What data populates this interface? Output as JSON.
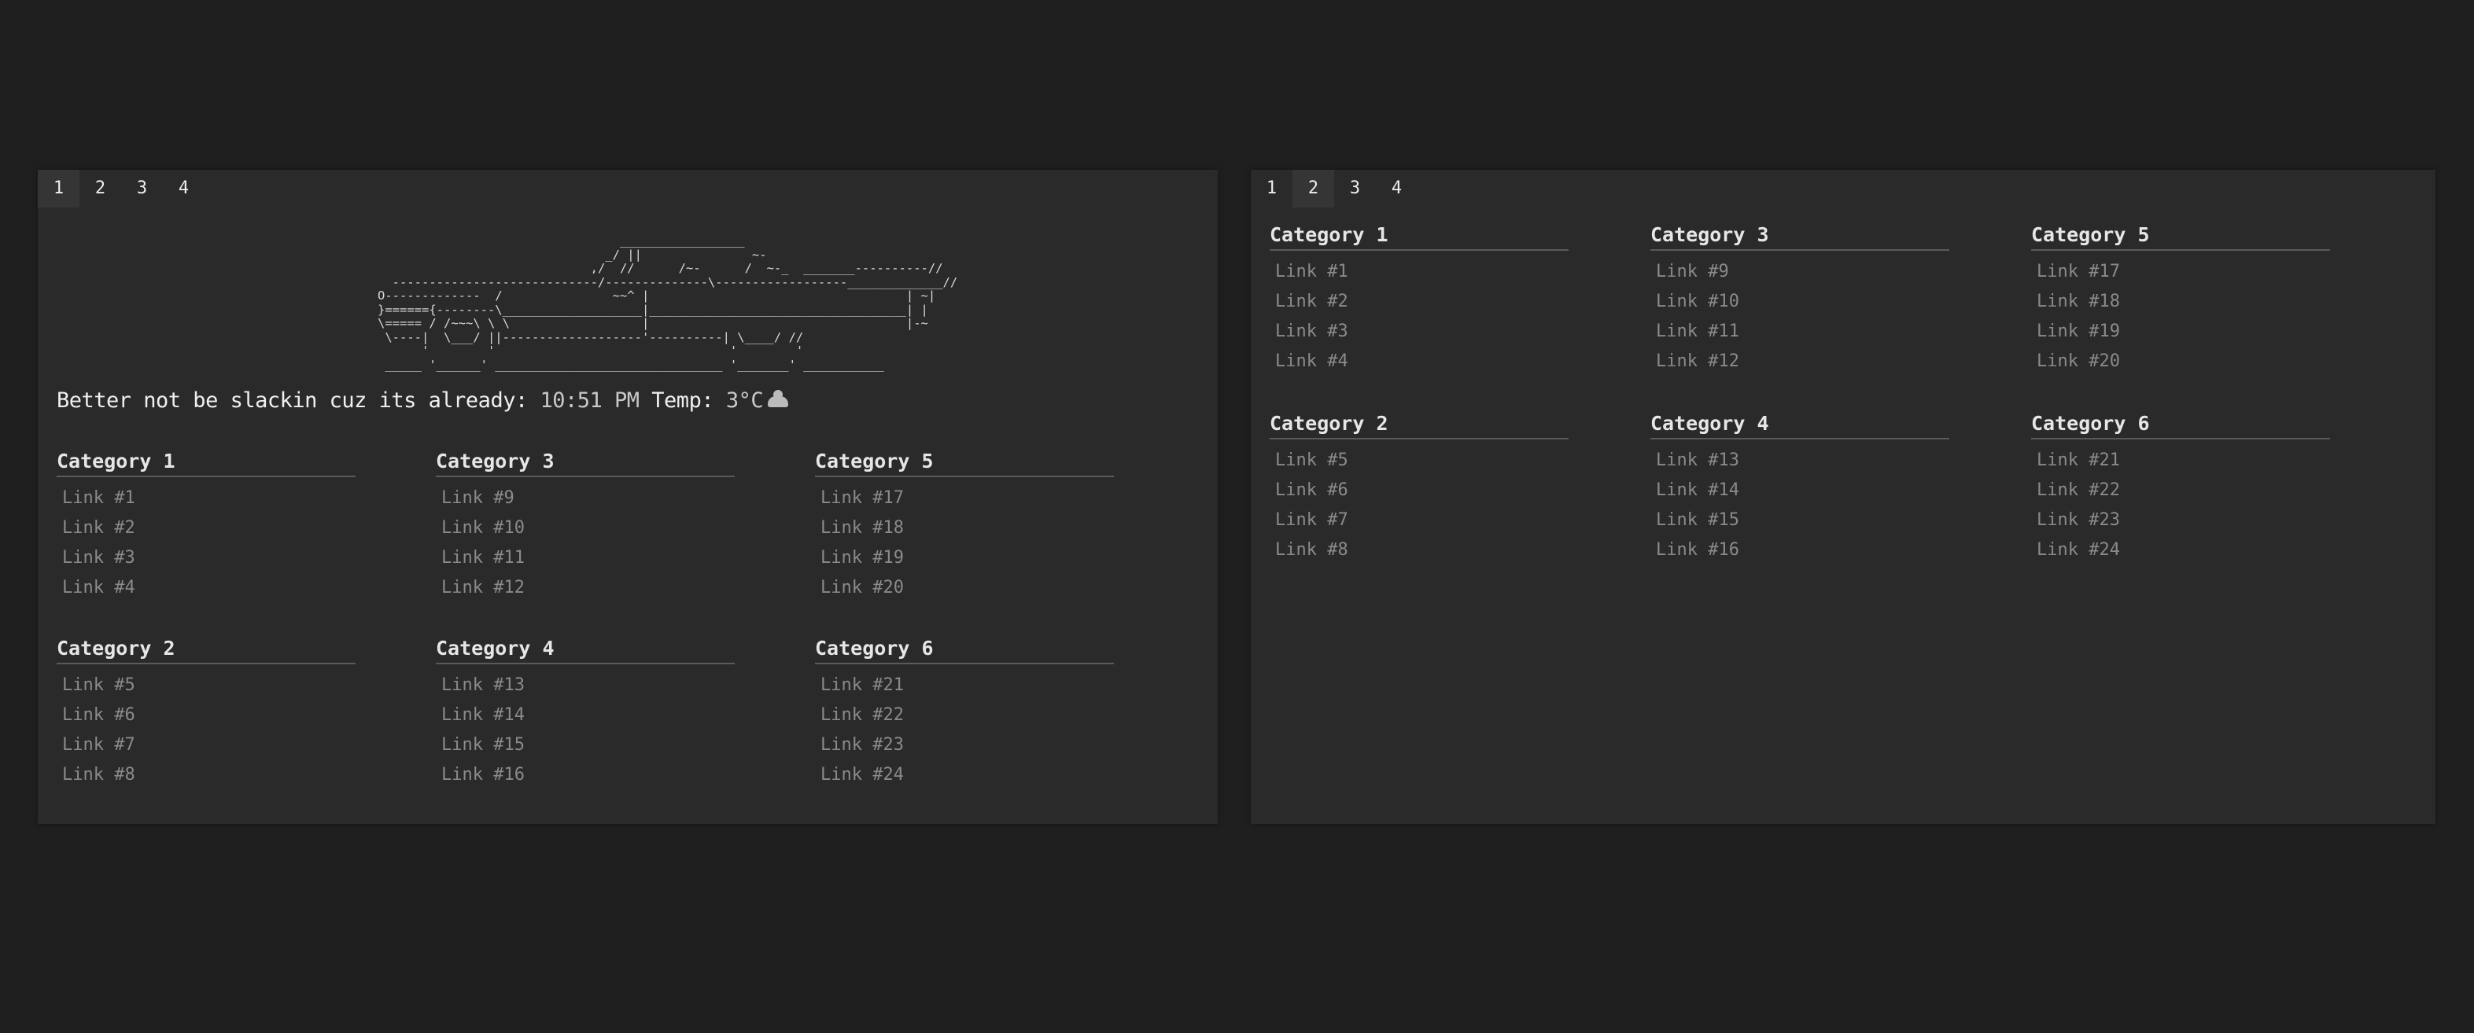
{
  "tabs": [
    "1",
    "2",
    "3",
    "4"
  ],
  "ascii_art": [
    "                                 _________________",
    "                               _/ ||               ~-",
    "                             ,/  //      /~-      /  ~-_  _______----------//",
    "  ----------------------------/--------------\\------------------_____________//",
    "O-------------  /               ~~^ |                                   | ~|",
    "}======{--------\\___________________|___________________________________| |",
    "\\===== / /~~~\\ \\ \\                  |                                   |-~",
    " \\----|  \\___/ ||-------------------'----------| \\____/ //",
    "      '        '                                '        '",
    " _____ '______' _______________________________ '_______' ___________"
  ],
  "greeting": {
    "text": "Better not be slackin cuz its already:",
    "time": "10:51 PM",
    "temp_label": "Temp:",
    "temp": "3°C",
    "weather_icon": "cloud-icon"
  },
  "categories": [
    {
      "title": "Category 1",
      "links": [
        "Link #1",
        "Link #2",
        "Link #3",
        "Link #4"
      ]
    },
    {
      "title": "Category 2",
      "links": [
        "Link #5",
        "Link #6",
        "Link #7",
        "Link #8"
      ]
    },
    {
      "title": "Category 3",
      "links": [
        "Link #9",
        "Link #10",
        "Link #11",
        "Link #12"
      ]
    },
    {
      "title": "Category 4",
      "links": [
        "Link #13",
        "Link #14",
        "Link #15",
        "Link #16"
      ]
    },
    {
      "title": "Category 5",
      "links": [
        "Link #17",
        "Link #18",
        "Link #19",
        "Link #20"
      ]
    },
    {
      "title": "Category 6",
      "links": [
        "Link #21",
        "Link #22",
        "Link #23",
        "Link #24"
      ]
    }
  ],
  "panels": [
    {
      "active_tab": "1"
    },
    {
      "active_tab": "2"
    }
  ]
}
